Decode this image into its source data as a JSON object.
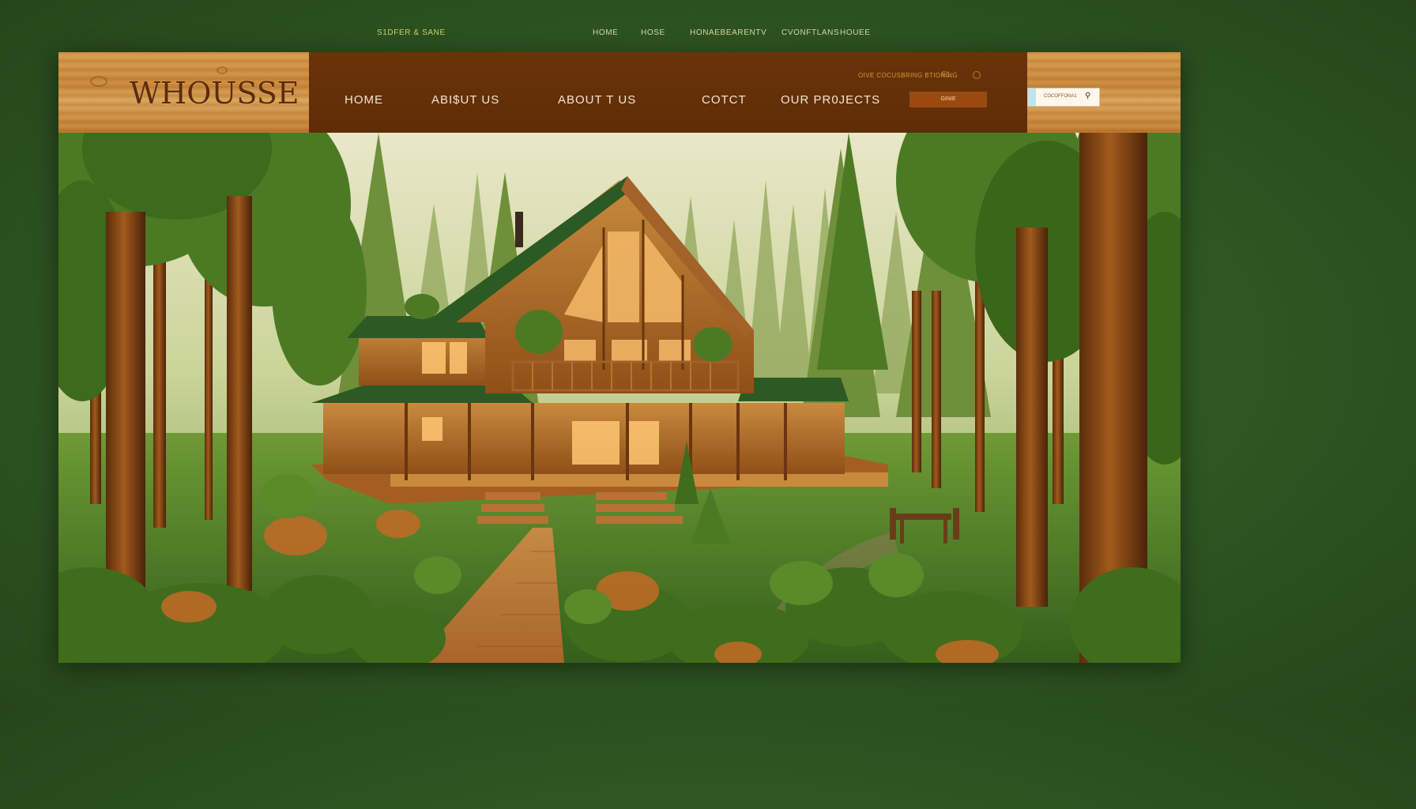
{
  "topbar": {
    "brand": "S1DFER & SANE",
    "links": [
      "HOME",
      "HOSE",
      "HONAEBEARENTV",
      "CVONFTLANS",
      "HOUEE"
    ]
  },
  "header": {
    "logo": "WHOUSSE",
    "nav": [
      "HOME",
      "ABI$UT US",
      "ABOUT T US",
      "COTCT",
      "OUR PR0JECTS"
    ],
    "tagline": "OIVE COCUSBRING BTIONING",
    "tag_icon": "F1",
    "button_label": "GINIE",
    "search_text": "COCOFFONA1",
    "search_icon": "magnifier-icon"
  },
  "colors": {
    "page_bg": "#2c5020",
    "nav_bg": "#5e2d07",
    "wood": "#c9863b",
    "logo": "#5c2c0c",
    "nav_text": "#f3e6d2"
  }
}
